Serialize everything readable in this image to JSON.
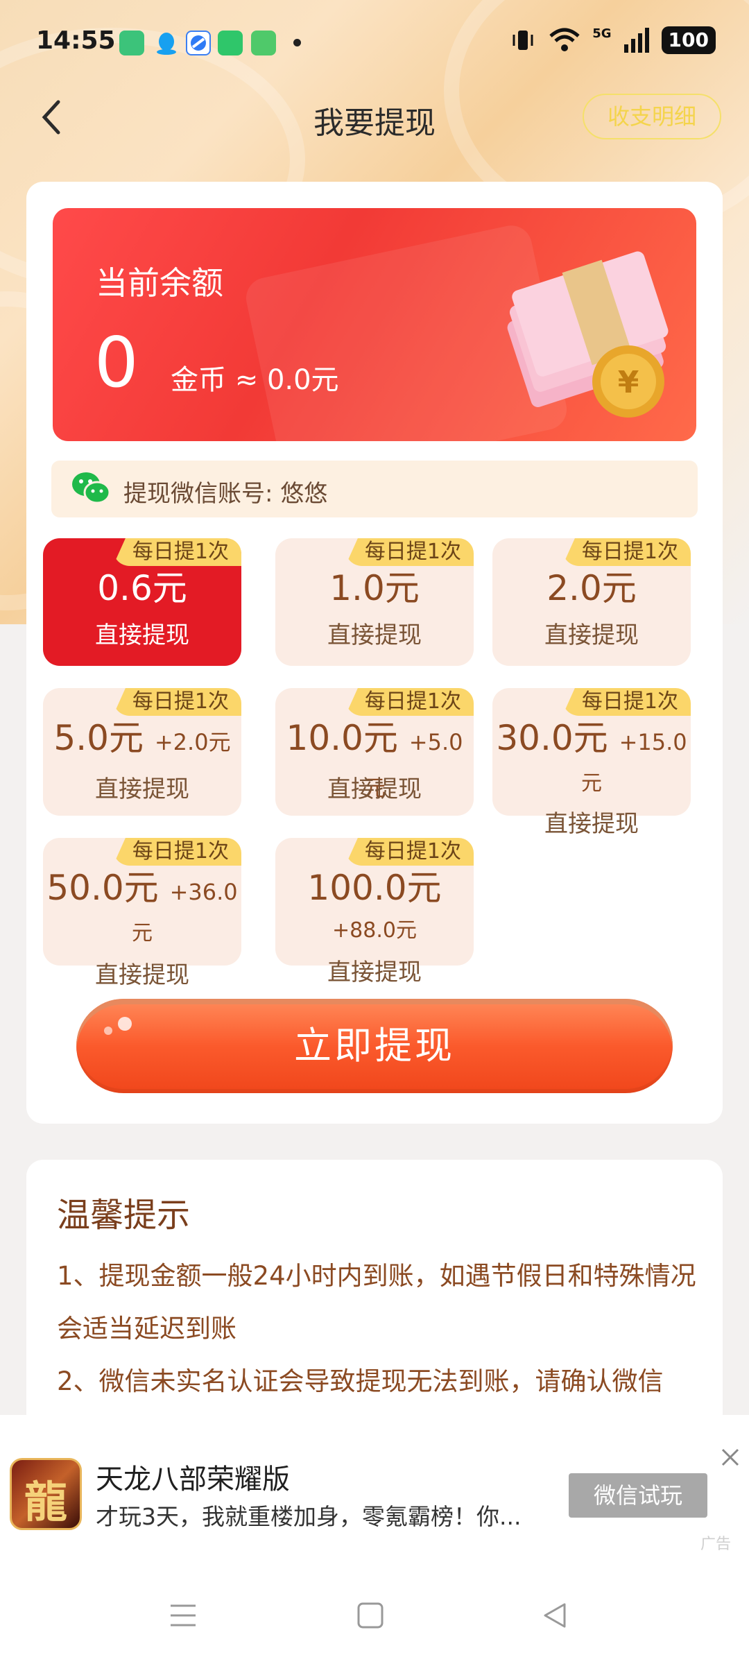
{
  "status_bar": {
    "time": "14:55",
    "network": "5G",
    "battery": "100"
  },
  "nav": {
    "title": "我要提现",
    "ledger_button": "收支明细"
  },
  "balance": {
    "label": "当前余额",
    "amount": "0",
    "unit_text": "金币 ≈ 0.0元"
  },
  "wechat": {
    "account_text": "提现微信账号: 悠悠"
  },
  "options": [
    {
      "tag": "每日提1次",
      "amount": "0.6元",
      "bonus": "",
      "sub": "直接提现",
      "selected": true
    },
    {
      "tag": "每日提1次",
      "amount": "1.0元",
      "bonus": "",
      "sub": "直接提现",
      "selected": false
    },
    {
      "tag": "每日提1次",
      "amount": "2.0元",
      "bonus": "",
      "sub": "直接提现",
      "selected": false
    },
    {
      "tag": "每日提1次",
      "amount": "5.0元",
      "bonus": "+2.0元",
      "sub": "直接提现",
      "selected": false
    },
    {
      "tag": "每日提1次",
      "amount": "10.0元",
      "bonus": "+5.0元",
      "sub": "直接提现",
      "selected": false
    },
    {
      "tag": "每日提1次",
      "amount": "30.0元",
      "bonus": "+15.0",
      "bonus2": "元",
      "sub": "直接提现",
      "selected": false
    },
    {
      "tag": "每日提1次",
      "amount": "50.0元",
      "bonus": "+36.0",
      "bonus2": "元",
      "sub": "直接提现",
      "selected": false
    },
    {
      "tag": "每日提1次",
      "amount": "100.0元",
      "bonus": "",
      "bonus2": "+88.0元",
      "sub": "直接提现",
      "selected": false
    }
  ],
  "submit_button": "立即提现",
  "tips": {
    "title": "温馨提示",
    "line1": "1、提现金额一般24小时内到账，如遇节假日和特殊情况会适当延迟到账",
    "line2": "2、微信未实名认证会导致提现无法到账，请确认微信"
  },
  "ad": {
    "icon_glyph": "龍",
    "title": "天龙八部荣耀版",
    "description": "才玩3天，我就重楼加身，零氪霸榜！你...",
    "button": "微信试玩",
    "label": "广告"
  },
  "colors": {
    "accent_red": "#e31b25",
    "submit_orange": "#fb5a2c",
    "tag_yellow": "#fbd66a",
    "text_brown": "#8b4a22"
  }
}
